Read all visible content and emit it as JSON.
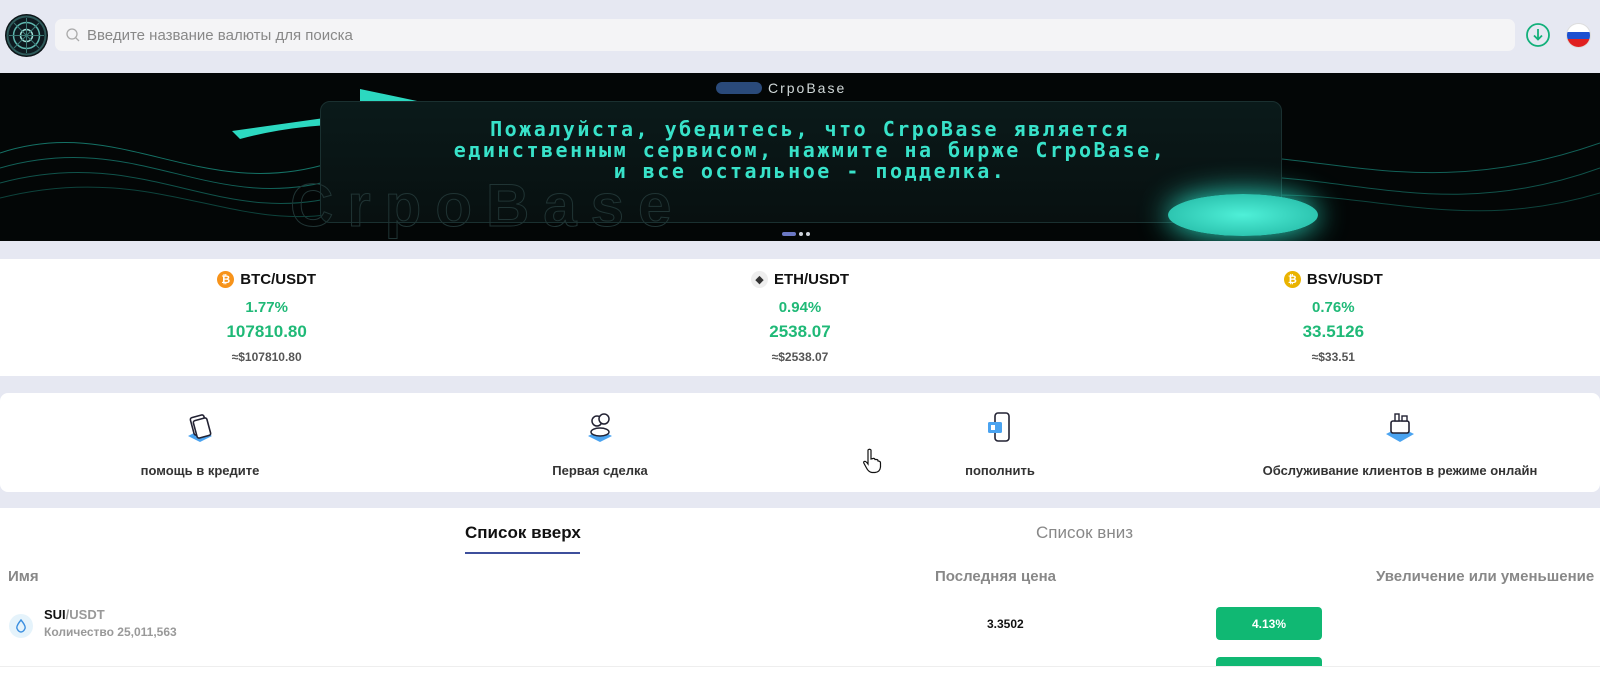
{
  "header": {
    "search_placeholder": "Введите название валюты для поиска",
    "language_flag": "ru-flag"
  },
  "banner": {
    "brand": "CrpoBase",
    "headline": "Пожалуйста, убедитесь, что CrpoBase является единственным сервисом, нажмите на бирже CrpoBase, и все остальное - подделка.",
    "slide_count": 4,
    "active_slide": 0
  },
  "tickers": [
    {
      "pair": "BTC/USDT",
      "icon": "bitcoin-icon",
      "color": "#f7931a",
      "pct": "1.77%",
      "price": "107810.80",
      "approx": "≈$107810.80"
    },
    {
      "pair": "ETH/USDT",
      "icon": "ethereum-icon",
      "color": "#3c3c3d",
      "pct": "0.94%",
      "price": "2538.07",
      "approx": "≈$2538.07"
    },
    {
      "pair": "BSV/USDT",
      "icon": "bsv-icon",
      "color": "#eab300",
      "pct": "0.76%",
      "price": "33.5126",
      "approx": "≈$33.51"
    }
  ],
  "quick_menu": [
    {
      "label": "помощь в кредите",
      "icon": "credit-help-icon"
    },
    {
      "label": "Первая сделка",
      "icon": "first-trade-icon"
    },
    {
      "label": "пополнить",
      "icon": "deposit-icon"
    },
    {
      "label": "Обслуживание клиентов в режиме онлайн",
      "icon": "support-icon"
    }
  ],
  "list": {
    "tab_up": "Список вверх",
    "tab_down": "Список вниз",
    "col_name": "Имя",
    "col_last": "Последняя цена",
    "col_change": "Увеличение или уменьшение",
    "rows": [
      {
        "base": "SUI",
        "quote": "/USDT",
        "volume": "Количество 25,011,563",
        "last": "3.3502",
        "change": "4.13%"
      }
    ]
  },
  "colors": {
    "accent": "#3e4f9c",
    "up": "#1fb977",
    "badge": "#10b873"
  }
}
